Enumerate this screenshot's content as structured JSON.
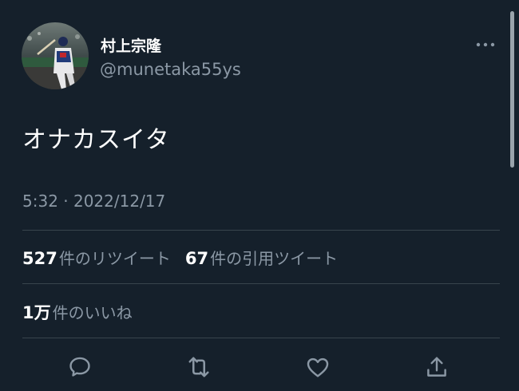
{
  "tweet": {
    "display_name": "村上宗隆",
    "handle": "@munetaka55ys",
    "text": "オナカスイタ",
    "timestamp": "5:32 · 2022/12/17",
    "retweets": {
      "count": "527",
      "label": "件のリツイート"
    },
    "quotes": {
      "count": "67",
      "label": "件の引用ツイート"
    },
    "likes": {
      "count": "1万",
      "label": "件のいいね"
    },
    "avatar_icon": "profile-photo-baseball-player",
    "more_icon": "ellipsis-icon"
  },
  "actions": {
    "items": [
      {
        "name": "reply",
        "icon": "speech-bubble-icon"
      },
      {
        "name": "retweet",
        "icon": "retweet-arrows-icon"
      },
      {
        "name": "like",
        "icon": "heart-icon"
      },
      {
        "name": "share",
        "icon": "share-upload-icon"
      }
    ]
  },
  "colors": {
    "background": "#15202b",
    "text_primary": "#ffffff",
    "text_secondary": "#8b98a5",
    "divider": "#38444d"
  }
}
